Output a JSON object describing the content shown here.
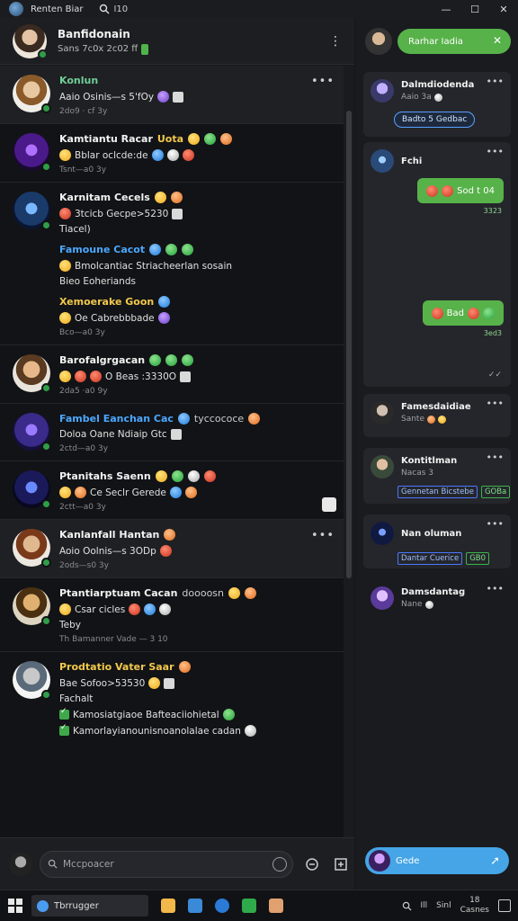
{
  "window": {
    "title": "Renten Biar",
    "search_label": "I10",
    "minimize": "—",
    "maximize": "☐",
    "close": "✕"
  },
  "chat_header": {
    "name": "Banfidonain",
    "status": "Sans 7c0x 2c02 ff",
    "menu": "⋮"
  },
  "messages": [
    {
      "sender": "Konlun",
      "lines": [
        "Aaio  Osinis—s 5'fOy"
      ],
      "time": "2do9 · cf 3y",
      "has_menu": true
    },
    {
      "sender": "Kamtiantu Racar",
      "sender_tag": "Uota",
      "lines": [
        "Bblar oclcde:de"
      ],
      "time": "Tsnt—a0  3y"
    },
    {
      "sender": "Karnitam Cecels",
      "lines": [
        "3tcicb  Gecpe>5230"
      ],
      "extra_line": "Tiacel)",
      "sub_blocks": [
        {
          "sender": "Famoune Cacot",
          "lines": [
            "Bmolcantiac Striacheerlan  sosain",
            "Bieo Eoheriands"
          ]
        },
        {
          "sender": "Xemoerake Goon",
          "lines": [
            "Oe  Cabrebbbade"
          ],
          "time": "Bco—a0  3y"
        }
      ]
    },
    {
      "sender": "Barofalgrgacan",
      "lines": [
        "O   Beas :3330O"
      ],
      "time": "2da5  ·a0  9y"
    },
    {
      "sender": "Fambel Eanchan  Cac",
      "sender_note": "tyccococe",
      "lines": [
        "Doloa  Oane  Ndiaip Gtc"
      ],
      "time": "2ctd—a0  3y"
    },
    {
      "sender": "Ptanitahs Saenn",
      "lines": [
        "Ce  Seclr   Gerede"
      ],
      "time": "2ctt—a0  3y"
    },
    {
      "sender": "Kanlanfall Hantan",
      "lines": [
        "Aoio  Oolnis—s 3ODp"
      ],
      "time": "2ods—s0  3y",
      "has_menu": true
    },
    {
      "sender": "Ptantiarptuam Cacan",
      "sender_note": "doooosn",
      "lines": [
        "Csar  cicles"
      ],
      "extra_line": "Teby",
      "time": "Th Bamanner   Vade — 3 10"
    },
    {
      "sender": "Prodtatio Vater Saar",
      "lines": [
        "Bae    Sofoo>53530"
      ],
      "extra_line": "Fachalt",
      "checklist": [
        "Kamosiatgiaoe Bafteaciiohietal",
        "Kamorlayianounisnoanolalae cadan"
      ]
    }
  ],
  "composer": {
    "placeholder": "Mccpoacer"
  },
  "right_panel": {
    "action_label": "Rarhar Iadia",
    "action_close": "✕",
    "cards": [
      {
        "name": "Dalmdiodenda",
        "sub": "Aaio 3a",
        "button": "Badto 5 Gedbac"
      },
      {
        "name": "Fchi",
        "bubbles": [
          {
            "text": "Sod t  04",
            "time": "3323"
          },
          {
            "text": "Bad",
            "time": "3ed3"
          }
        ]
      },
      {
        "name": "Famesdaidiae",
        "sub": "Sante"
      },
      {
        "name": "Kontitlman",
        "sub": "Nacas 3",
        "tags": [
          "Gennetan Bicstebe",
          "GOBa"
        ]
      },
      {
        "name": "Nan oluman",
        "tags": [
          "Dantar Cuerice",
          "GB0"
        ]
      },
      {
        "name": "Damsdantag",
        "sub": "Nane"
      }
    ],
    "bottom_label": "Gede",
    "send_icon": "➚"
  },
  "taskbar": {
    "app_label": "Tbrrugger",
    "tray_a": "Ill",
    "tray_b": "Sinl",
    "clock_time": "18",
    "clock_date": "Casnes"
  },
  "colors": {
    "accent_green": "#58b24a",
    "accent_blue": "#45a5e6",
    "background": "#121316"
  }
}
